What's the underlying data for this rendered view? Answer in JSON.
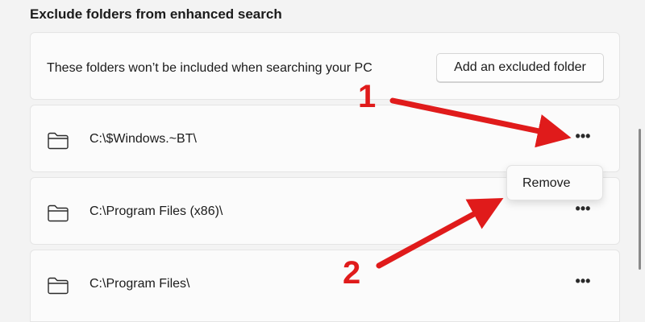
{
  "section": {
    "title": "Exclude folders from enhanced search"
  },
  "header_card": {
    "description": "These folders won’t be included when searching your PC",
    "add_button_label": "Add an excluded folder"
  },
  "folders": [
    {
      "path": "C:\\$Windows.~BT\\",
      "icon": "folder-icon",
      "more_label": "•••"
    },
    {
      "path": "C:\\Program Files (x86)\\",
      "icon": "folder-icon",
      "more_label": "•••"
    },
    {
      "path": "C:\\Program Files\\",
      "icon": "folder-icon",
      "more_label": "•••"
    }
  ],
  "context_menu": {
    "items": [
      {
        "label": "Remove"
      }
    ]
  },
  "annotations": {
    "step_1": "1",
    "step_2": "2",
    "color": "#e01b1b"
  }
}
